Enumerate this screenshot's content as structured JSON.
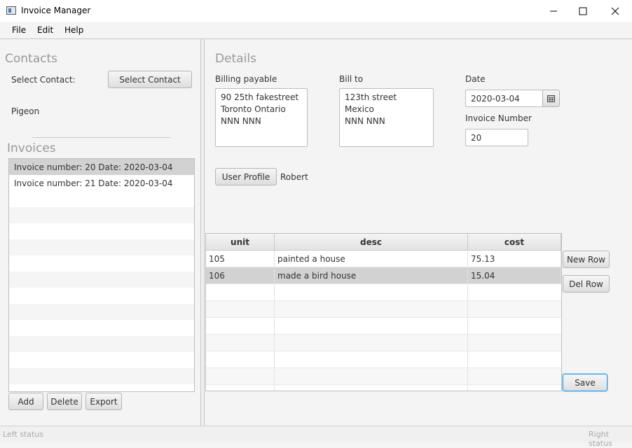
{
  "window": {
    "title": "Invoice Manager",
    "minimize": "—",
    "maximize": "☐",
    "close": "✕"
  },
  "menu": [
    "File",
    "Edit",
    "Help"
  ],
  "contacts": {
    "section_title": "Contacts",
    "select_label": "Select Contact:",
    "select_button": "Select Contact",
    "selected_name": "Pigeon"
  },
  "invoices": {
    "section_title": "Invoices",
    "items": [
      "Invoice number: 20 Date: 2020-03-04",
      "Invoice number: 21 Date: 2020-03-04"
    ],
    "add_button": "Add",
    "delete_button": "Delete",
    "export_button": "Export"
  },
  "details": {
    "section_title": "Details",
    "billing_payable_label": "Billing payable",
    "billing_payable_value": "90 25th fakestreet\nToronto Ontario\nNNN NNN",
    "bill_to_label": "Bill to",
    "bill_to_value": "123th street\nMexico\nNNN NNN",
    "date_label": "Date",
    "date_value": "2020-03-04",
    "invoice_number_label": "Invoice Number",
    "invoice_number_value": "20",
    "user_profile_button": "User Profile",
    "user_name": "Robert"
  },
  "table": {
    "columns": [
      "unit",
      "desc",
      "cost"
    ],
    "rows": [
      [
        "105",
        "painted a house",
        "75.13"
      ],
      [
        "106",
        "made a bird house",
        "15.04"
      ]
    ],
    "new_row_button": "New Row",
    "del_row_button": "Del Row",
    "save_button": "Save"
  },
  "status": {
    "left": "Left status",
    "right": "Right status"
  }
}
